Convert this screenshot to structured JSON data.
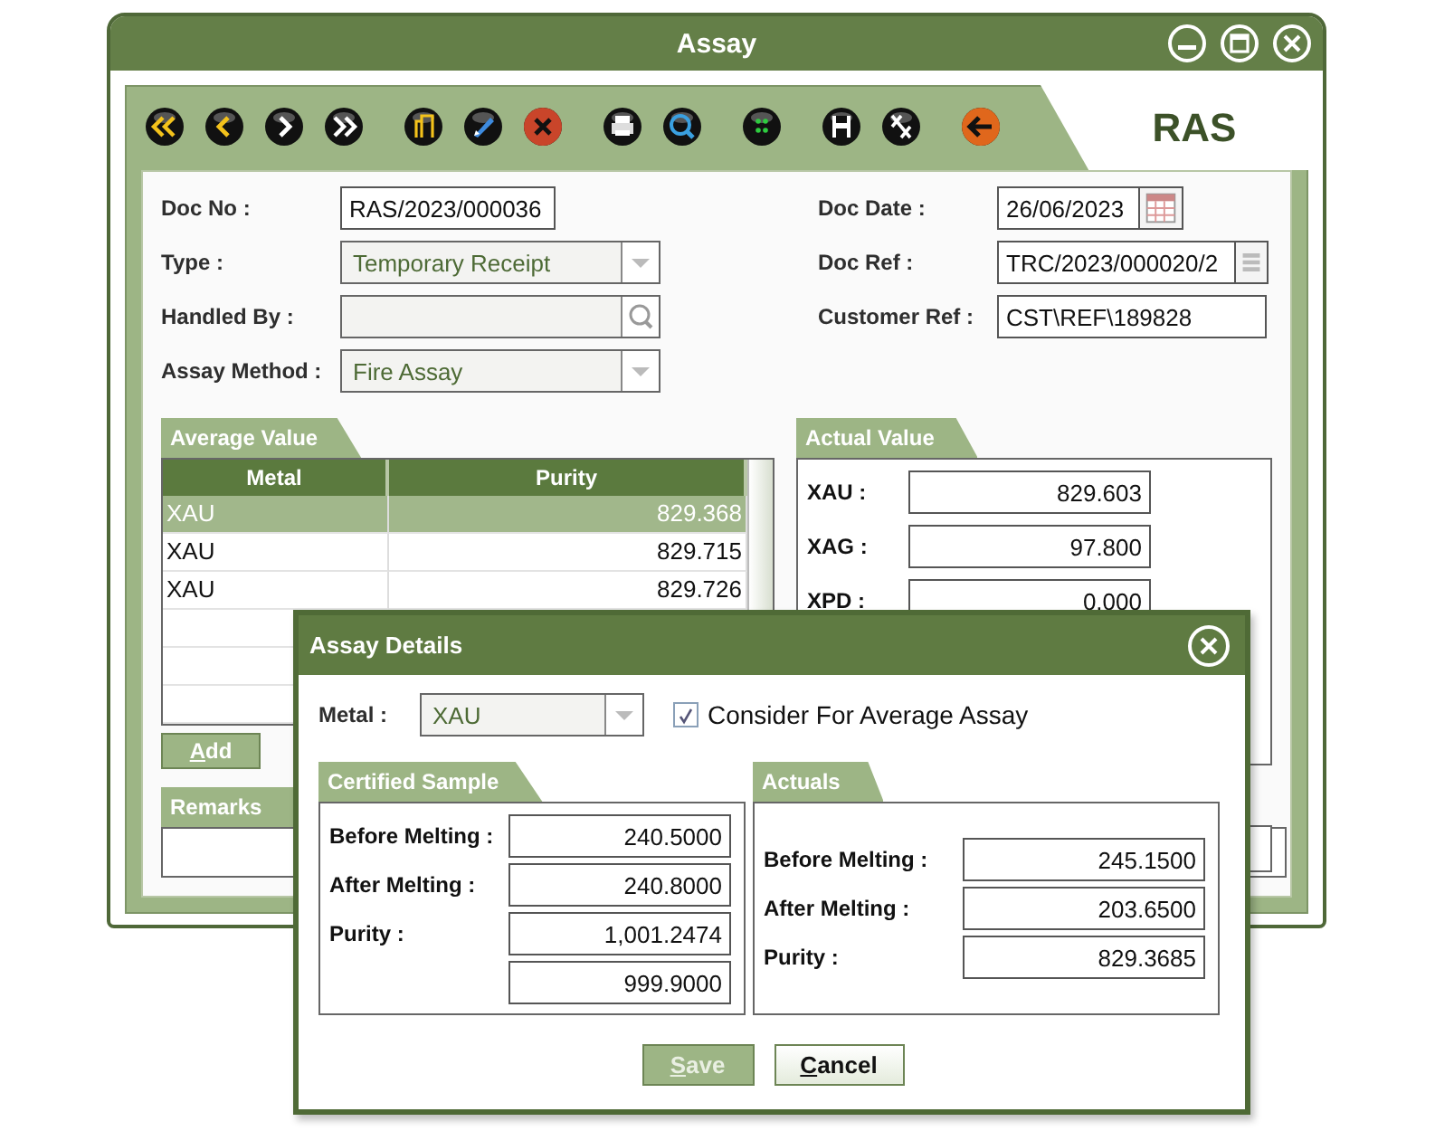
{
  "window": {
    "title": "Assay"
  },
  "module_tab": "RAS",
  "form": {
    "left": [
      {
        "label": "Doc No :",
        "value": "RAS/2023/000036",
        "kind": "text"
      },
      {
        "label": "Type :",
        "value": "Temporary Receipt",
        "kind": "dropdown"
      },
      {
        "label": "Handled By :",
        "kind": "lookup"
      },
      {
        "label": "Assay Method :",
        "value": "Fire Assay",
        "kind": "dropdown"
      }
    ],
    "right": [
      {
        "label": "Doc Date :",
        "value": "26/06/2023",
        "kind": "date"
      },
      {
        "label": "Doc Ref :",
        "value": "TRC/2023/000020/2",
        "kind": "list"
      },
      {
        "label": "Customer Ref :",
        "value": "CST\\REF\\189828",
        "kind": "text"
      }
    ]
  },
  "average_value": {
    "title": "Average Value",
    "columns": [
      "Metal",
      "Purity"
    ],
    "rows": [
      {
        "cells": [
          "XAU",
          "829.368"
        ],
        "selected": true
      },
      {
        "cells": [
          "XAU",
          "829.715"
        ],
        "selected": false
      },
      {
        "cells": [
          "XAU",
          "829.726"
        ],
        "selected": false
      }
    ],
    "buttons": [
      {
        "label": "Add",
        "underline_first": true
      }
    ]
  },
  "actual_value": {
    "title": "Actual Value",
    "rows": [
      {
        "label": "XAU :",
        "value": "829.603"
      },
      {
        "label": "XAG :",
        "value": "97.800"
      },
      {
        "label": "XPD :",
        "value": "0.000"
      }
    ]
  },
  "remarks": {
    "title": "Remarks"
  },
  "dialog": {
    "title": "Assay Details",
    "metal": {
      "label": "Metal :",
      "value": "XAU"
    },
    "consider": {
      "label": "Consider For Average Assay",
      "checked": true
    },
    "certified_sample": {
      "title": "Certified Sample",
      "rows": [
        {
          "label": "Before Melting :",
          "value": "240.5000"
        },
        {
          "label": "After Melting :",
          "value": "240.8000"
        },
        {
          "label": "Purity :",
          "value": "1,001.2474"
        },
        {
          "value": "999.9000"
        }
      ]
    },
    "actuals": {
      "title": "Actuals",
      "rows": [
        {
          "label": "Before Melting :",
          "value": "245.1500"
        },
        {
          "label": "After Melting :",
          "value": "203.6500"
        },
        {
          "label": "Purity :",
          "value": "829.3685"
        }
      ]
    },
    "buttons": [
      {
        "label": "Save",
        "disabled": true,
        "underline_first": true
      },
      {
        "label": "Cancel",
        "disabled": false,
        "underline_first": true
      }
    ]
  }
}
